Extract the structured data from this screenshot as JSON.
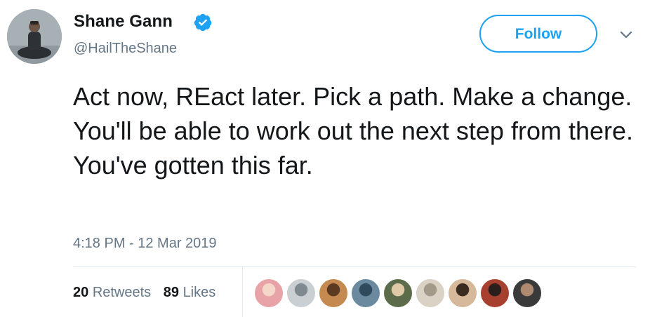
{
  "user": {
    "display_name": "Shane Gann",
    "handle": "@HailTheShane",
    "verified": true,
    "avatar_icon": "user-avatar"
  },
  "actions": {
    "follow_label": "Follow",
    "menu_icon": "chevron-down-icon"
  },
  "tweet": {
    "text": "Act now, REact later. Pick a path. Make a change. You'll be able to work out the next step from there. You've gotten this far.",
    "timestamp": "4:18 PM - 12 Mar 2019"
  },
  "stats": {
    "retweets_count": "20",
    "retweets_label": "Retweets",
    "likes_count": "89",
    "likes_label": "Likes"
  },
  "likers": [
    {
      "color": "#e8a3a8",
      "accent": "#f4d7c9"
    },
    {
      "color": "#c9cfd3",
      "accent": "#7f8a90"
    },
    {
      "color": "#c48a4f",
      "accent": "#5b3a22"
    },
    {
      "color": "#6b8aa0",
      "accent": "#2f4a5c"
    },
    {
      "color": "#5c6b4a",
      "accent": "#e0c9a6"
    },
    {
      "color": "#d9d2c5",
      "accent": "#a39a8a"
    },
    {
      "color": "#d6b89a",
      "accent": "#3b2c22"
    },
    {
      "color": "#a8402f",
      "accent": "#2a1f1c"
    },
    {
      "color": "#3a3a3a",
      "accent": "#b08a70"
    }
  ],
  "colors": {
    "accent": "#1da1f2",
    "text": "#14171a",
    "secondary": "#657786",
    "divider": "#e1e8ed"
  }
}
